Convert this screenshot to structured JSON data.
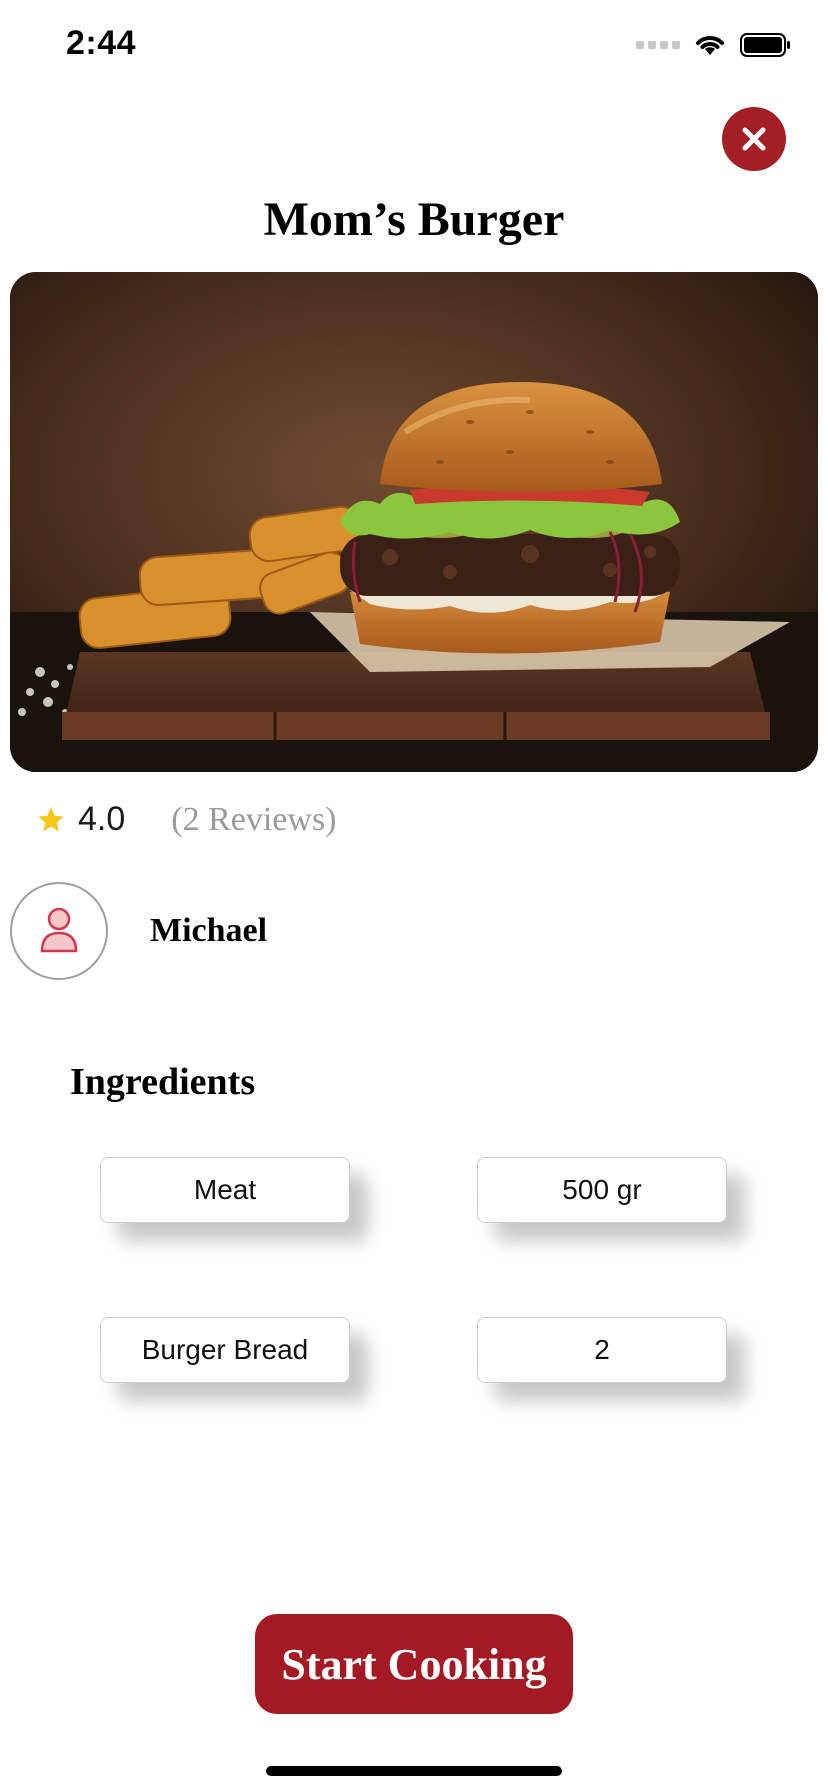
{
  "status_bar": {
    "time": "2:44"
  },
  "recipe": {
    "title": "Mom’s Burger",
    "rating": "4.0",
    "reviews": "(2 Reviews)",
    "author": "Michael"
  },
  "ingredients": {
    "heading": "Ingredients",
    "items": [
      {
        "name": "Meat",
        "amount": "500 gr"
      },
      {
        "name": "Burger Bread",
        "amount": "2"
      }
    ]
  },
  "actions": {
    "start_label": "Start Cooking"
  },
  "colors": {
    "accent": "#a31a24",
    "star": "#f5c518",
    "muted_text": "#9a9a9a"
  },
  "icons": {
    "close": "close-icon",
    "star": "star-icon",
    "avatar": "person-icon"
  }
}
